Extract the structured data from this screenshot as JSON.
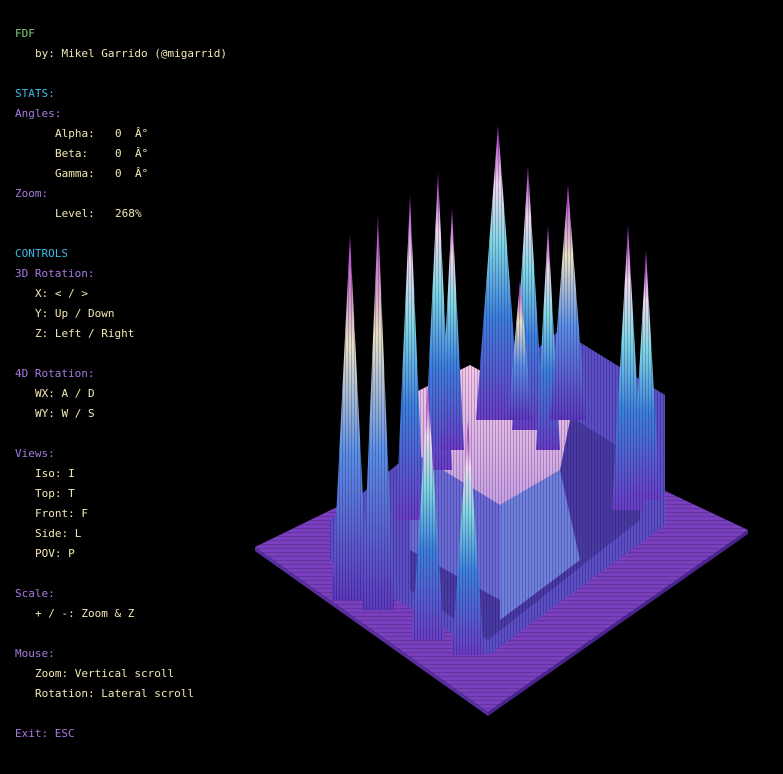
{
  "header": {
    "title": "FDF",
    "author": "by: Mikel Garrido (@migarrid)"
  },
  "stats": {
    "heading": "STATS:",
    "angles_label": "Angles:",
    "alpha_label": "Alpha:",
    "alpha_value": "0",
    "alpha_unit": "Â°",
    "beta_label": "Beta:",
    "beta_value": "0",
    "beta_unit": "Â°",
    "gamma_label": "Gamma:",
    "gamma_value": "0",
    "gamma_unit": "Â°",
    "zoom_label": "Zoom:",
    "level_label": "Level:",
    "level_value": "268",
    "level_unit": "%"
  },
  "controls": {
    "heading": "CONTROLS",
    "rot3d_label": "3D Rotation:",
    "rot3d_x": "X: < / >",
    "rot3d_y": "Y: Up / Down",
    "rot3d_z": "Z: Left / Right",
    "rot4d_label": "4D Rotation:",
    "rot4d_wx": "WX: A / D",
    "rot4d_wy": "WY: W / S",
    "views_label": "Views:",
    "view_iso": "Iso: I",
    "view_top": "Top: T",
    "view_front": "Front: F",
    "view_side": "Side: L",
    "view_pov": "POV: P",
    "scale_label": "Scale:",
    "scale_keys": "+ / -: Zoom & Z",
    "mouse_label": "Mouse:",
    "mouse_zoom": "Zoom: Vertical scroll",
    "mouse_rotation": "Rotation: Lateral scroll",
    "exit": "Exit: ESC"
  },
  "colors": {
    "background": "#000000",
    "title": "#7ed27e",
    "section": "#3ab8e8",
    "label": "#a57ae0",
    "value": "#f1e6b6",
    "mesh_base": "#7a3fbf",
    "mesh_mid": "#3d7fe0",
    "mesh_high": "#f0b8e8"
  }
}
